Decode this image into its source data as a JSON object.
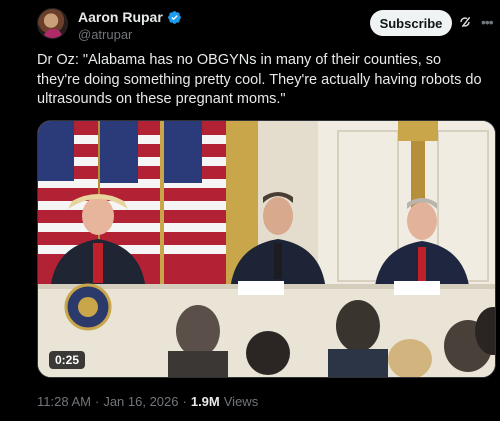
{
  "author": {
    "name": "Aaron Rupar",
    "handle": "@atrupar",
    "verified": true,
    "accent_color": "#1d9bf0"
  },
  "actions": {
    "subscribe_label": "Subscribe",
    "grok_icon": "grok-icon",
    "more_icon": "more-icon"
  },
  "tweet": {
    "text": "Dr Oz: \"Alabama has no OBGYNs in many of their counties, so they're doing something pretty cool. They're actually having robots do ultrasounds on these pregnant moms.\""
  },
  "media": {
    "type": "video",
    "duration": "0:25"
  },
  "meta": {
    "time": "11:28 AM",
    "separator": "·",
    "date": "Jan 16, 2026",
    "separator2": "·",
    "views_count": "1.9M",
    "views_label": "Views"
  }
}
